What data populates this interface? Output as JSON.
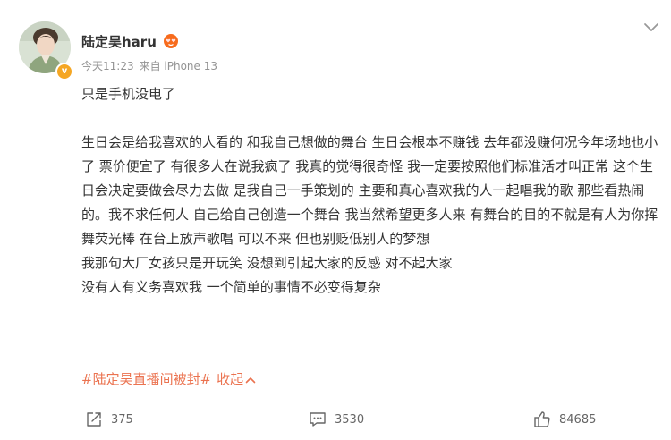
{
  "post": {
    "username": "陆定昊haru",
    "time": "今天11:23",
    "source": "来自 iPhone 13",
    "content": [
      "只是手机没电了",
      "",
      "生日会是给我喜欢的人看的 和我自己想做的舞台 生日会根本不赚钱 去年都没赚何况今年场地也小了 票价便宜了 有很多人在说我疯了 我真的觉得很奇怪 我一定要按照他们标准活才叫正常 这个生日会决定要做会尽力去做 是我自己一手策划的 主要和真心喜欢我的人一起唱我的歌 那些看热闹的。我不求任何人 自己给自己创造一个舞台 我当然希望更多人来 有舞台的目的不就是有人为你挥舞荧光棒 在台上放声歌唱 可以不来 但也别贬低别人的梦想",
      "我那句大厂女孩只是开玩笑 没想到引起大家的反感 对不起大家",
      "没有人有义务喜欢我 一个简单的事情不必变得复杂"
    ],
    "topic": "#陆定昊直播间被封#",
    "collapse_label": "收起"
  },
  "actions": {
    "repost_count": "375",
    "comment_count": "3530",
    "like_count": "84685"
  },
  "icons": {
    "avatar": "user-avatar",
    "verified": "verified-badge-icon",
    "fan_badge": "heart-face-icon",
    "menu": "chevron-down-icon",
    "collapse": "chevron-up-icon",
    "repost": "repost-icon",
    "comment": "comment-icon",
    "like": "thumbs-up-icon"
  },
  "colors": {
    "topic": "#eb7350",
    "text": "#333333",
    "meta": "#939393",
    "action_text": "#666666",
    "verified": "#f5a623"
  }
}
